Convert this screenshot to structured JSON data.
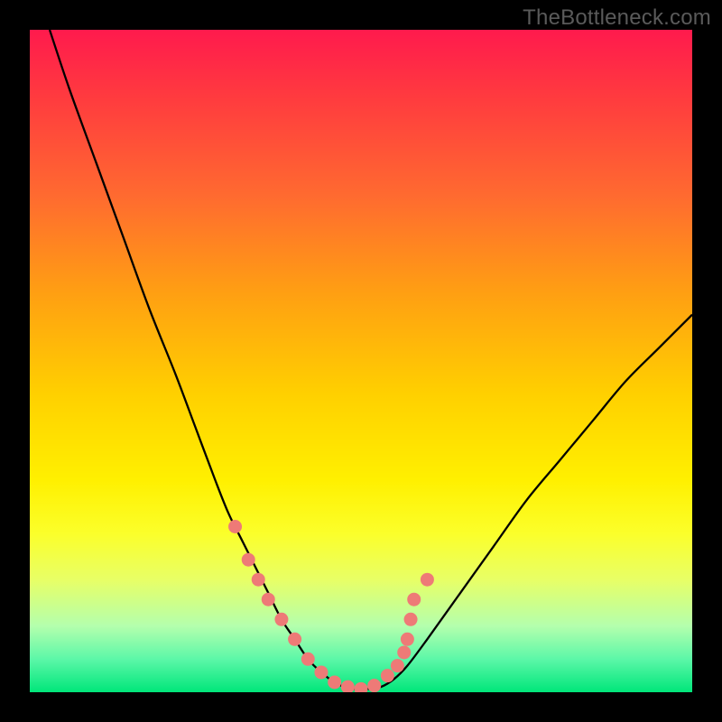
{
  "watermark": "TheBottleneck.com",
  "colors": {
    "curve": "#000000",
    "marker_fill": "#ee7a77",
    "marker_stroke": "#d6605e",
    "gradient_top": "#ff1a4d",
    "gradient_bottom": "#00e67a",
    "frame": "#000000"
  },
  "chart_data": {
    "type": "line",
    "title": "",
    "xlabel": "",
    "ylabel": "",
    "xlim": [
      0,
      100
    ],
    "ylim": [
      0,
      100
    ],
    "series": [
      {
        "name": "bottleneck-curve",
        "x": [
          3,
          6,
          10,
          14,
          18,
          22,
          25,
          28,
          30,
          32,
          34,
          36,
          38,
          40,
          42,
          44,
          46,
          47.5,
          49,
          51,
          53,
          55,
          57,
          60,
          65,
          70,
          75,
          80,
          85,
          90,
          95,
          100
        ],
        "y": [
          100,
          91,
          80,
          69,
          58,
          48,
          40,
          32,
          27,
          23,
          19,
          15,
          11,
          8,
          5,
          3,
          1.5,
          0.8,
          0.5,
          0.5,
          0.8,
          2,
          4,
          8,
          15,
          22,
          29,
          35,
          41,
          47,
          52,
          57
        ]
      }
    ],
    "markers": {
      "name": "highlight-points",
      "x": [
        31,
        33,
        34.5,
        36,
        38,
        40,
        42,
        44,
        46,
        48,
        50,
        52,
        54,
        55.5,
        56.5,
        57,
        57.5,
        58,
        60
      ],
      "y": [
        25,
        20,
        17,
        14,
        11,
        8,
        5,
        3,
        1.5,
        0.8,
        0.5,
        1,
        2.5,
        4,
        6,
        8,
        11,
        14,
        17
      ]
    }
  }
}
